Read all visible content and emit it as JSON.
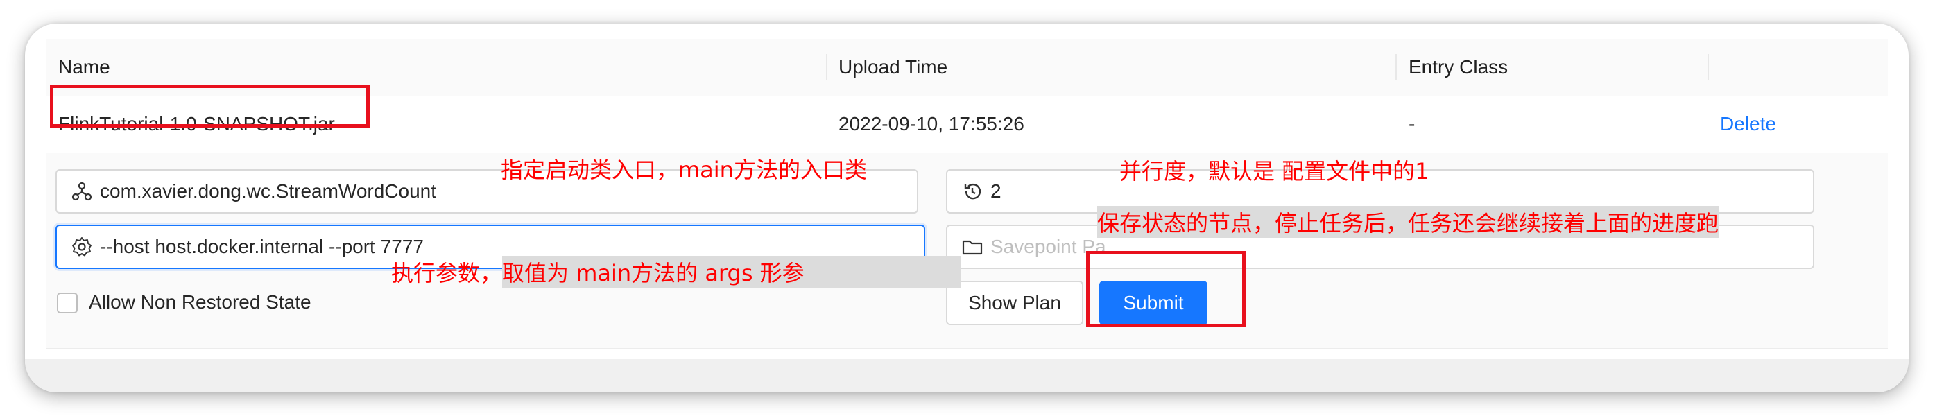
{
  "table": {
    "headers": {
      "name": "Name",
      "upload_time": "Upload Time",
      "entry_class": "Entry Class"
    },
    "row": {
      "name": "FlinkTutorial-1.0-SNAPSHOT.jar",
      "upload_time": "2022-09-10, 17:55:26",
      "entry_class": "-",
      "delete": "Delete"
    }
  },
  "form": {
    "entry_class_value": "com.xavier.dong.wc.StreamWordCount",
    "parallelism_value": "2",
    "program_args_value": "--host host.docker.internal --port 7777",
    "savepoint_placeholder": "Savepoint Pa",
    "allow_non_restored_label": "Allow Non Restored State",
    "show_plan_label": "Show Plan",
    "submit_label": "Submit"
  },
  "icons": {
    "entry_class": "cluster-icon",
    "parallelism": "history-icon",
    "program_args": "setting-icon",
    "savepoint": "folder-icon"
  },
  "annotations": {
    "entry_class_note": "指定启动类入口，main方法的入口类",
    "parallelism_note": "并行度，默认是 配置文件中的1",
    "savepoint_note": "保存状态的节点，停止任务后，任务还会继续接着上面的进度跑",
    "args_note_prefix": "执行参数，",
    "args_note_highlight": "取值为 main方法的 args 形参"
  },
  "colors": {
    "primary": "#1677ff",
    "annotation": "#ff0000",
    "highlight_box": "#e8101d"
  }
}
